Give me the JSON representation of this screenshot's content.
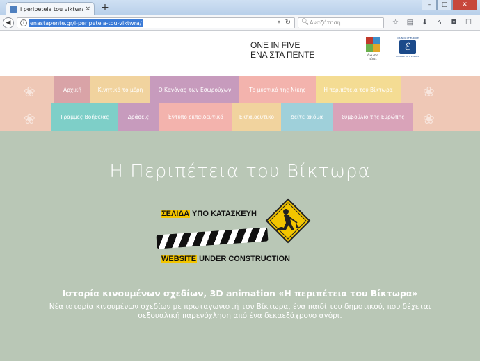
{
  "browser": {
    "tab_title": "i peripeteia tou viktwra – Εισ",
    "tab_close": "×",
    "new_tab": "+",
    "url": "enastapente.gr/i-peripeteia-tou-viktwra/",
    "search_placeholder": "Αναζήτηση",
    "window_controls": [
      "–",
      "▢",
      "✕"
    ]
  },
  "header": {
    "title_en": "ONE IN FIVE",
    "title_gr": "ΕΝΑ ΣΤΑ ΠΕΝΤΕ",
    "logo_one_text": "ένα στα πέντε",
    "logo_coe_top": "COUNCIL OF EUROPE",
    "logo_coe_bottom": "CONSEIL DE L'EUROPE"
  },
  "menu": {
    "row1": [
      {
        "label": "Αρχική",
        "color": "#d9a3a7"
      },
      {
        "label": "Κινητικό το μέρη",
        "color": "#f1d39e"
      },
      {
        "label": "Ο Κανόνας των Εσωρούχων",
        "color": "#c79bbd"
      },
      {
        "label": "Το μυστικό της Νίκης",
        "color": "#f3b3ad"
      },
      {
        "label": "Η περιπέτεια του Βίκτωρα",
        "color": "#f4dc93"
      }
    ],
    "row2": [
      {
        "label": "Γραμμές Βοήθειας",
        "color": "#7ecfc8"
      },
      {
        "label": "Δράσεις",
        "color": "#c79bbd"
      },
      {
        "label": "Έντυπο εκπαιδευτικό",
        "color": "#f3b3ad"
      },
      {
        "label": "Εκπαιδευτικό",
        "color": "#f1d39e"
      },
      {
        "label": "Δείτε ακόμα",
        "color": "#9fd0da"
      },
      {
        "label": "Συμβούλιο της Ευρώπης",
        "color": "#d9a3b9"
      }
    ]
  },
  "main": {
    "title": "Η Περιπέτεια του Βίκτωρα",
    "construction_top_highlight": "ΣΕΛΙΔΑ",
    "construction_top_rest": " ΥΠΟ ΚΑΤΑΣΚΕΥΗ",
    "construction_bottom_highlight": "WEBSITE",
    "construction_bottom_rest": " UNDER CONSTRUCTION",
    "description_title": "Ιστορία κινουμένων σχεδίων, 3D animation «Η περιπέτεια του Βίκτωρα»",
    "description_text": "Νέα ιστορία κινουμένων σχεδίων με πρωταγωνιστή τον Βίκτωρα, ένα παιδί του δημοτικού, που δέχεται σεξουαλική παρενόχληση από ένα δεκαεξάχρονο αγόρι."
  },
  "colors": {
    "page_bg": "#b9c7b6",
    "menu_bg": "#efc8b6",
    "url_highlight": "#3b7bd7"
  }
}
